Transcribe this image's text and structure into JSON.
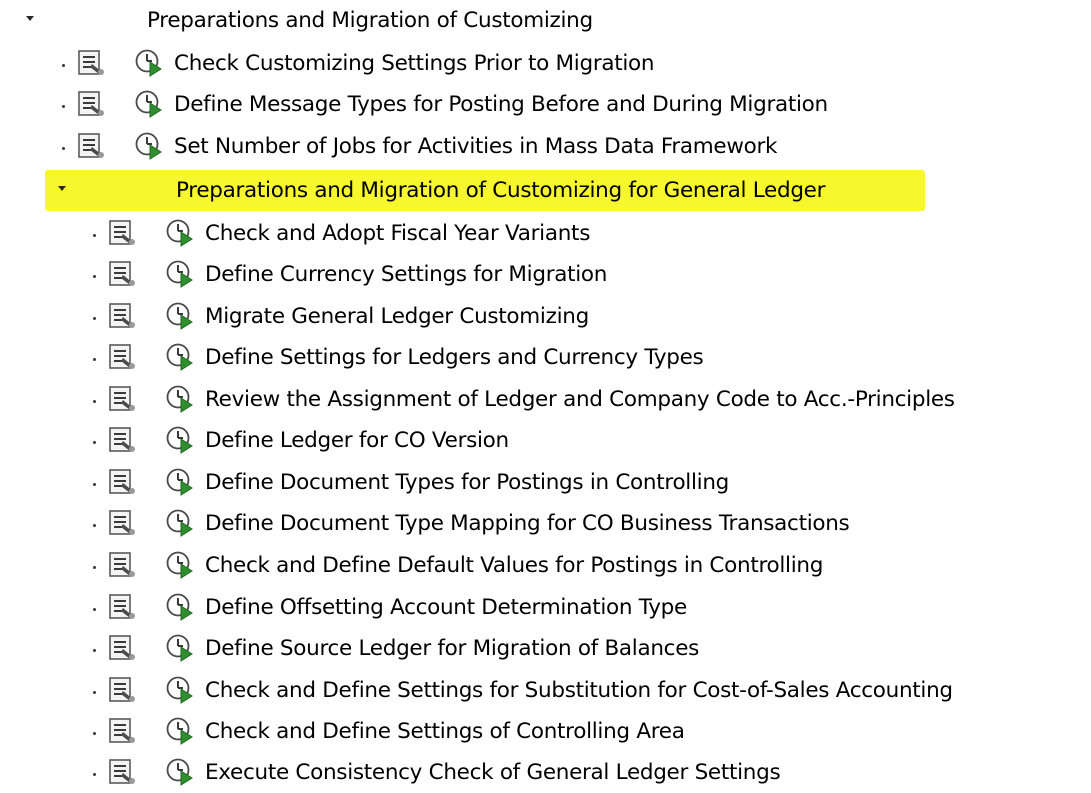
{
  "tree": {
    "root": {
      "label": "Preparations and Migration of Customizing",
      "children": [
        {
          "label": "Check Customizing Settings Prior to Migration"
        },
        {
          "label": "Define Message Types for Posting Before and During Migration"
        },
        {
          "label": "Set Number of Jobs for Activities in Mass Data Framework"
        }
      ]
    },
    "subfolder": {
      "label": "Preparations and Migration of Customizing for General Ledger",
      "highlight_color": "#ffff00",
      "children": [
        {
          "label": "Check and Adopt Fiscal Year Variants"
        },
        {
          "label": "Define Currency Settings for Migration"
        },
        {
          "label": "Migrate General Ledger Customizing"
        },
        {
          "label": "Define Settings for Ledgers and Currency Types"
        },
        {
          "label": "Review the Assignment of Ledger and Company Code to Acc.-Principles"
        },
        {
          "label": "Define Ledger for CO Version"
        },
        {
          "label": "Define Document Types for Postings in Controlling"
        },
        {
          "label": "Define Document Type Mapping for CO Business Transactions"
        },
        {
          "label": "Check and Define Default Values for Postings in Controlling"
        },
        {
          "label": "Define Offsetting Account Determination Type"
        },
        {
          "label": "Define Source Ledger for Migration of Balances"
        },
        {
          "label": "Check and Define Settings for Substitution for Cost-of-Sales Accounting"
        },
        {
          "label": "Check and Define Settings of Controlling Area"
        },
        {
          "label": "Execute Consistency Check of General Ledger Settings"
        }
      ]
    }
  },
  "icons": {
    "documentation": "document-icon",
    "execute": "execute-clock-icon",
    "expanded": "caret-down-icon",
    "leaf_bullet": "dot-bullet"
  }
}
